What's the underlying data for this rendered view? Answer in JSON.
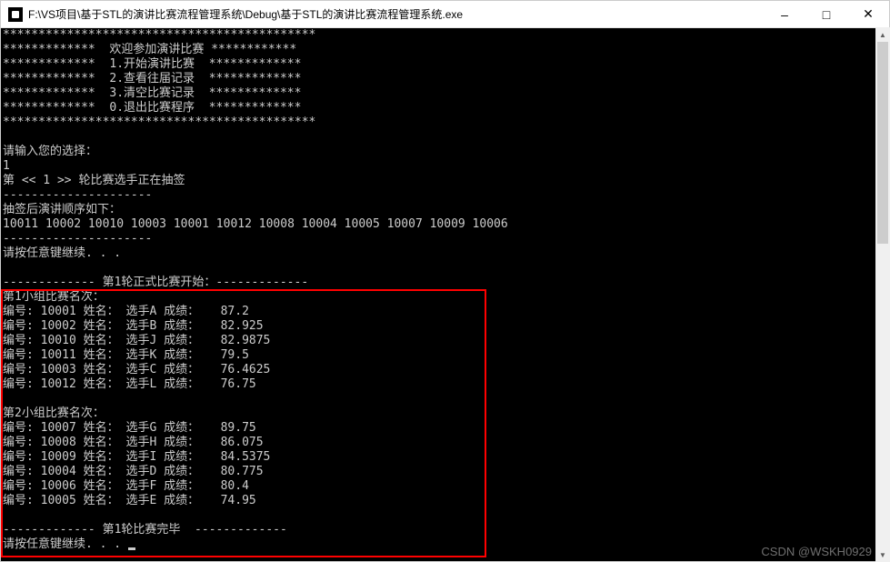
{
  "window": {
    "title": "F:\\VS项目\\基于STL的演讲比赛流程管理系统\\Debug\\基于STL的演讲比赛流程管理系统.exe"
  },
  "menu": {
    "border_top": "********************************************",
    "welcome": "*************  欢迎参加演讲比赛 ************",
    "opt1": "*************  1.开始演讲比赛  *************",
    "opt2": "*************  2.查看往届记录  *************",
    "opt3": "*************  3.清空比赛记录  *************",
    "opt0": "*************  0.退出比赛程序  *************",
    "border_bottom": "********************************************"
  },
  "prompt": {
    "ask": "请输入您的选择：",
    "input": "1",
    "round_drawing": "第 << 1 >> 轮比赛选手正在抽签"
  },
  "draw": {
    "dash": "---------------------",
    "order_label": "抽签后演讲顺序如下：",
    "order_ids": "10011 10002 10010 10003 10001 10012 10008 10004 10005 10007 10009 10006",
    "dash2": "---------------------"
  },
  "continue1": "请按任意键继续. . .",
  "round1": {
    "start": "------------- 第1轮正式比赛开始：------------- ",
    "group1_title": "第1小组比赛名次：",
    "group1": [
      {
        "id": "10001",
        "name": "选手A",
        "score": "87.2"
      },
      {
        "id": "10002",
        "name": "选手B",
        "score": "82.925"
      },
      {
        "id": "10010",
        "name": "选手J",
        "score": "82.9875"
      },
      {
        "id": "10011",
        "name": "选手K",
        "score": "79.5"
      },
      {
        "id": "10003",
        "name": "选手C",
        "score": "76.4625"
      },
      {
        "id": "10012",
        "name": "选手L",
        "score": "76.75"
      }
    ],
    "group2_title": "第2小组比赛名次：",
    "group2": [
      {
        "id": "10007",
        "name": "选手G",
        "score": "89.75"
      },
      {
        "id": "10008",
        "name": "选手H",
        "score": "86.075"
      },
      {
        "id": "10009",
        "name": "选手I",
        "score": "84.5375"
      },
      {
        "id": "10004",
        "name": "选手D",
        "score": "80.775"
      },
      {
        "id": "10006",
        "name": "选手F",
        "score": "80.4"
      },
      {
        "id": "10005",
        "name": "选手E",
        "score": "74.95"
      }
    ],
    "end": "------------- 第1轮比赛完毕  ------------- "
  },
  "continue2": "请按任意键继续. . . ",
  "labels": {
    "id": "编号: ",
    "name": " 姓名： ",
    "score": " 成绩： "
  },
  "watermark": "CSDN @WSKH0929"
}
